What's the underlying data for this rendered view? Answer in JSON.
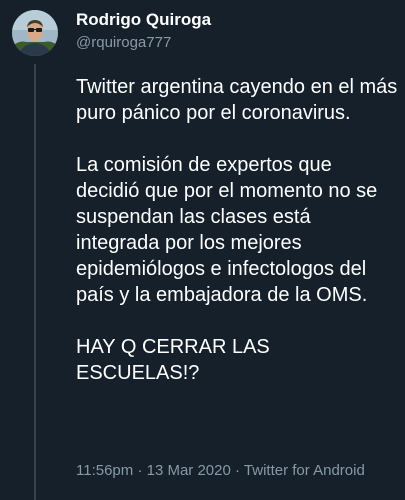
{
  "author": {
    "display_name": "Rodrigo Quiroga",
    "handle": "@rquiroga777"
  },
  "tweet": {
    "paragraphs": [
      "Twitter argentina cayendo en el más puro pánico por el coronavirus.",
      "La comisión de expertos que decidió que por el momento no se suspendan las clases está integrada por los mejores epidemiólogos e infectologos del país y la embajadora de la OMS.",
      "HAY Q CERRAR LAS ESCUELAS!?"
    ],
    "time": "11:56pm",
    "separator": "·",
    "date": "13 Mar 2020",
    "source": "Twitter for Android"
  },
  "colors": {
    "background": "#15202b",
    "text_primary": "#ffffff",
    "text_secondary": "#8899a6",
    "thread_line": "#38444d"
  }
}
